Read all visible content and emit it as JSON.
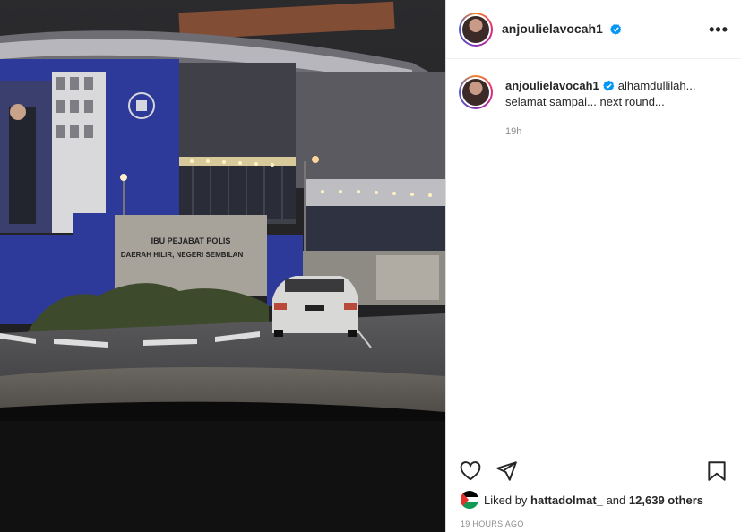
{
  "post": {
    "image_alt": "Night photo of police headquarters building with parked white car",
    "sign_line1": "IBU PEJABAT POLIS",
    "sign_line2": "DAERAH HILIR, NEGERI SEMBILAN"
  },
  "header": {
    "username": "anjoulielavocah1",
    "verified_icon": "verified-badge-icon",
    "more_label": "•••"
  },
  "caption": {
    "username": "anjoulielavocah1",
    "line1": "alhamdullilah...",
    "line2": "selamat sampai... next round...",
    "time": "19h"
  },
  "actions": {
    "like_icon": "heart-icon",
    "share_icon": "send-icon",
    "save_icon": "bookmark-icon"
  },
  "likes": {
    "prefix": "Liked by",
    "user": "hattadolmat_",
    "conj": "and",
    "others": "12,639 others"
  },
  "posted": "19 HOURS AGO",
  "colors": {
    "accent": "#0095f6",
    "text": "#262626",
    "muted": "#8e8e8e"
  }
}
